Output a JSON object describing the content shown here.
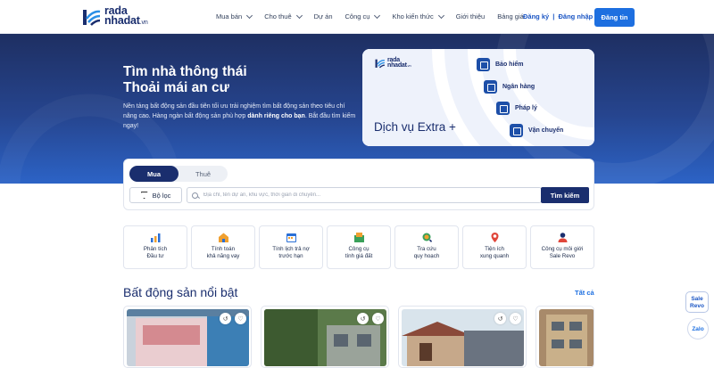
{
  "brand": {
    "name_line1": "rada",
    "name_line2": "nhadat",
    "domain": ".vn"
  },
  "nav": [
    {
      "label": "Mua bán",
      "dropdown": true
    },
    {
      "label": "Cho thuê",
      "dropdown": true
    },
    {
      "label": "Dự án",
      "dropdown": false
    },
    {
      "label": "Công cụ",
      "dropdown": true
    },
    {
      "label": "Kho kiến thức",
      "dropdown": true
    },
    {
      "label": "Giới thiệu",
      "dropdown": false
    },
    {
      "label": "Bảng giá",
      "dropdown": false
    }
  ],
  "auth": {
    "register": "Đăng ký",
    "separator": "|",
    "login": "Đăng nhập"
  },
  "post_button": "Đăng tin",
  "hero": {
    "title_line1": "Tìm nhà thông thái",
    "title_line2": "Thoải mái an cư",
    "desc_part1": "Nền tảng bất động sản đầu tiên tối ưu trải nghiệm tìm bất động sản theo tiêu chí nâng cao. Hàng ngàn bất động sản phù hợp ",
    "desc_bold": "dành riêng cho bạn",
    "desc_part2": ". Bắt đầu tìm kiếm ngay!"
  },
  "promo": {
    "title": "Dịch vụ Extra +",
    "services": [
      "Bảo hiểm",
      "Ngân hàng",
      "Pháp lý",
      "Vận chuyển"
    ]
  },
  "search": {
    "tabs": [
      "Mua",
      "Thuê"
    ],
    "active_tab": "Mua",
    "filter_label": "Bộ lọc",
    "placeholder": "Địa chỉ, tên dự án, khu vực, thời gian di chuyển...",
    "button": "Tìm kiếm"
  },
  "tools": [
    {
      "line1": "Phân tích",
      "line2": "Đầu tư"
    },
    {
      "line1": "Tính toán",
      "line2": "khả năng vay"
    },
    {
      "line1": "Tính lịch trả nợ",
      "line2": "trước hạn"
    },
    {
      "line1": "Công cụ",
      "line2": "tính giá đất"
    },
    {
      "line1": "Tra cứu",
      "line2": "quy hoạch"
    },
    {
      "line1": "Tiện ích",
      "line2": "xung quanh"
    },
    {
      "line1": "Công cụ môi giới",
      "line2": "Sale Revo"
    }
  ],
  "featured": {
    "title": "Bất động sản nổi bật",
    "see_all": "Tất cả"
  },
  "floating": {
    "sale_revo_line1": "Sale",
    "sale_revo_line2": "Revo",
    "zalo": "Zalo"
  },
  "colors": {
    "primary": "#1a2e6e",
    "accent": "#1d6fe0",
    "hero_top": "#1e2f62",
    "hero_bottom": "#2c63c6"
  }
}
